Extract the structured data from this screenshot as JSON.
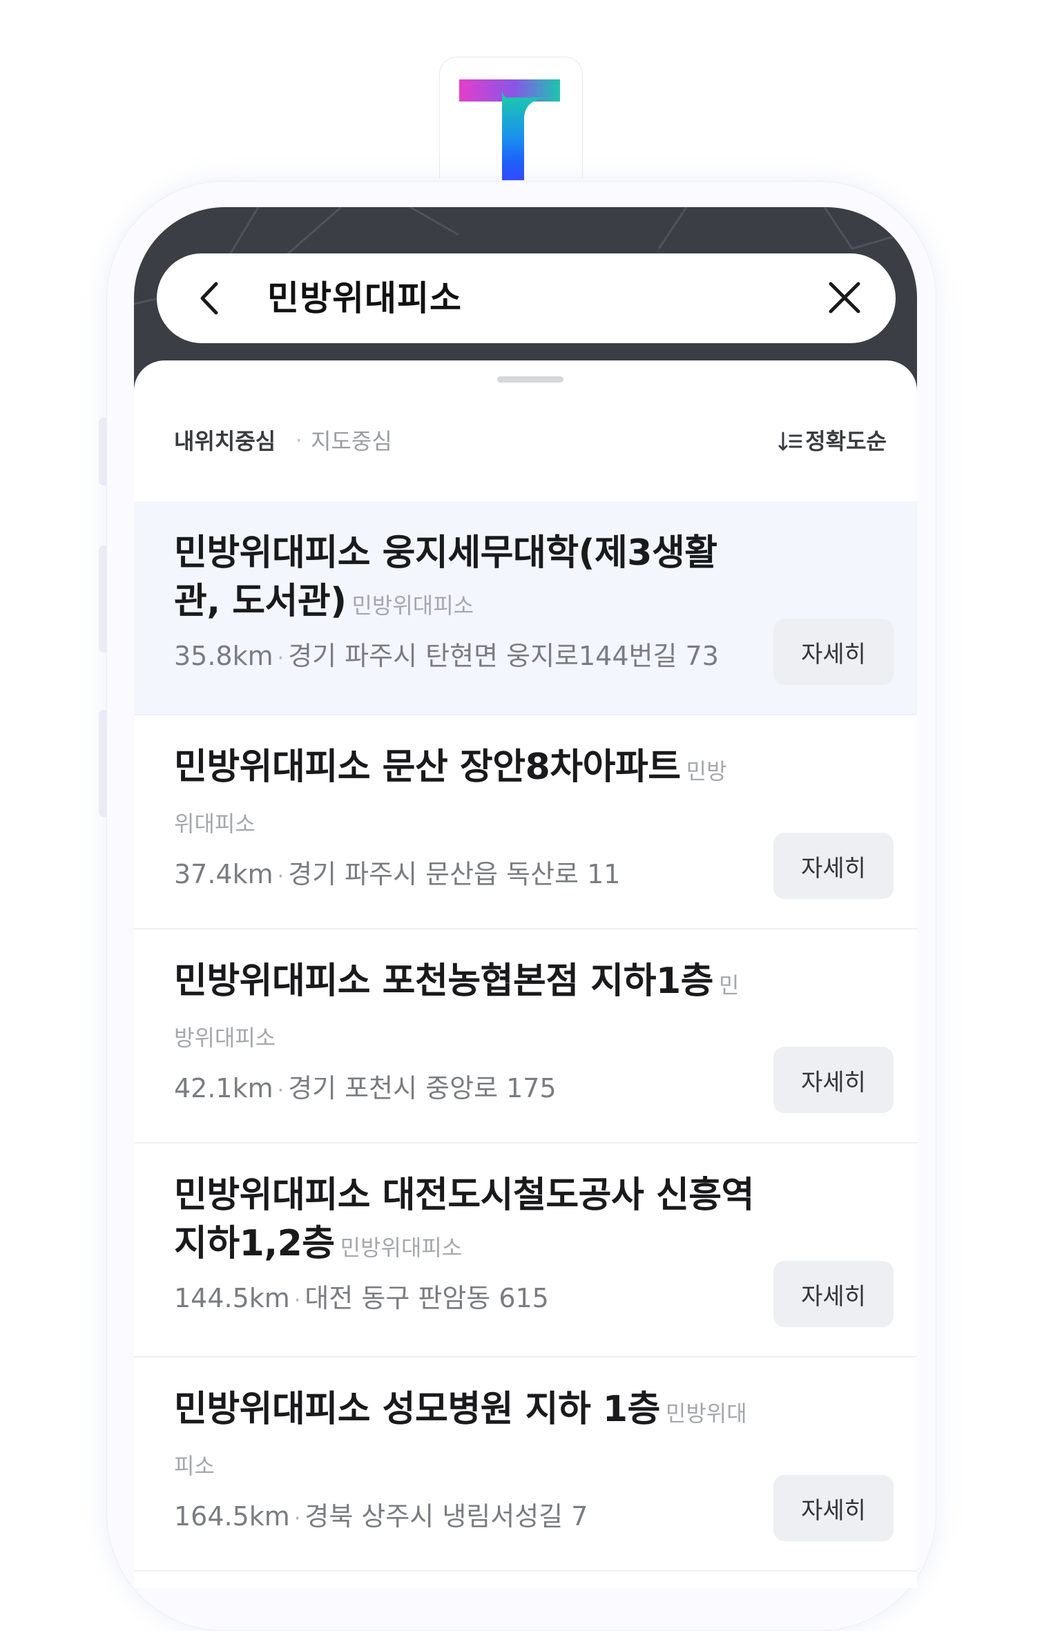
{
  "search": {
    "query": "민방위대피소"
  },
  "filter": {
    "active": "내위치중심",
    "separator": "·",
    "inactive": "지도중심",
    "sort_label": "정확도순"
  },
  "results": [
    {
      "title": "민방위대피소 웅지세무대학(제3생활관, 도서관)",
      "category": "민방위대피소",
      "distance": "35.8km",
      "address": "경기 파주시 탄현면 웅지로144번길 73",
      "button": "자세히"
    },
    {
      "title": "민방위대피소 문산 장안8차아파트",
      "category": "민방위대피소",
      "distance": "37.4km",
      "address": "경기 파주시 문산읍 독산로 11",
      "button": "자세히"
    },
    {
      "title": "민방위대피소 포천농협본점 지하1층",
      "category": "민방위대피소",
      "distance": "42.1km",
      "address": "경기 포천시 중앙로 175",
      "button": "자세히"
    },
    {
      "title": "민방위대피소 대전도시철도공사 신흥역 지하1,2층",
      "category": "민방위대피소",
      "distance": "144.5km",
      "address": "대전 동구 판암동 615",
      "button": "자세히"
    },
    {
      "title": "민방위대피소 성모병원 지하 1층",
      "category": "민방위대피소",
      "distance": "164.5km",
      "address": "경북 상주시 냉림서성길 7",
      "button": "자세히"
    }
  ],
  "colors": {
    "accent_gradient_start": "#e23fc9",
    "accent_gradient_end": "#1f5cff",
    "accent_teal": "#1bc6b0",
    "map_bg": "#3b3e45"
  }
}
